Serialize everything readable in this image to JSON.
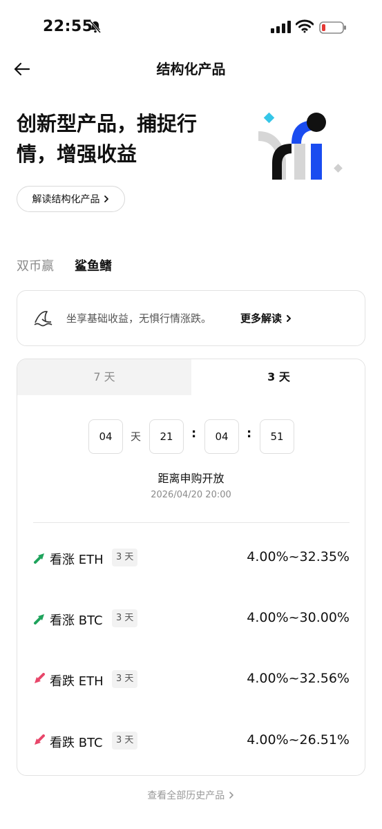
{
  "status_bar": {
    "time": "22:55"
  },
  "header": {
    "title": "结构化产品"
  },
  "hero": {
    "line1": "创新型产品，捕捉行",
    "line2": "情，增强收益",
    "explain_button": "解读结构化产品"
  },
  "product_tabs": [
    {
      "label": "双币赢",
      "active": false
    },
    {
      "label": "鲨鱼鳍",
      "active": true
    }
  ],
  "info": {
    "text": "坐享基础收益，无惧行情涨跌。",
    "more": "更多解读"
  },
  "period_tabs": [
    {
      "label": "7 天",
      "active": false
    },
    {
      "label": "3 天",
      "active": true
    }
  ],
  "countdown": {
    "days": "04",
    "day_unit": "天",
    "hours": "21",
    "minutes": "04",
    "seconds": "51",
    "title": "距离申购开放",
    "date": "2026/04/20 20:00"
  },
  "products": [
    {
      "direction": "up",
      "name": "看涨 ETH",
      "term": "3 天",
      "rate": "4.00%~32.35%"
    },
    {
      "direction": "up",
      "name": "看涨 BTC",
      "term": "3 天",
      "rate": "4.00%~30.00%"
    },
    {
      "direction": "down",
      "name": "看跌 ETH",
      "term": "3 天",
      "rate": "4.00%~32.56%"
    },
    {
      "direction": "down",
      "name": "看跌 BTC",
      "term": "3 天",
      "rate": "4.00%~26.51%"
    }
  ],
  "history_link": "查看全部历史产品",
  "colors": {
    "up": "#1fa35c",
    "down": "#e8476a",
    "brand_blue": "#1a4cf0",
    "accent_cyan": "#35c6e8"
  }
}
